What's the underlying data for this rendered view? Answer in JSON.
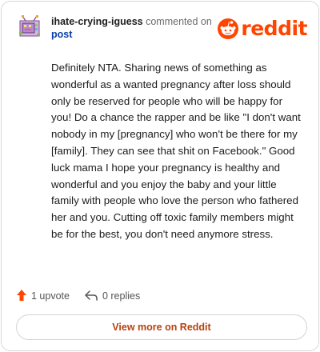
{
  "header": {
    "username": "ihate-crying-iguess",
    "action_text": "commented on",
    "post_link": "post",
    "avatar_icon": "pixel-tv-avatar-icon"
  },
  "brand": {
    "logo_icon": "reddit-snoo-icon",
    "wordmark": "reddit",
    "color": "#ff4500"
  },
  "comment": {
    "text": "Definitely NTA. Sharing news of something as wonderful as a wanted pregnancy after loss should only be reserved for people who will be happy for you! Do a chance the rapper and be like \"I don't want nobody in my [pregnancy] who won't be there for my [family]. They can see that shit on Facebook.\" Good luck mama I hope your pregnancy is healthy and wonderful and you enjoy the baby and your little family with people who love the person who fathered her and you. Cutting off toxic family members might be for the best, you don't need anymore stress."
  },
  "actions": {
    "upvote_icon": "upvote-arrow-icon",
    "upvote_label": "1 upvote",
    "reply_icon": "reply-arrow-icon",
    "replies_label": "0 replies"
  },
  "footer": {
    "view_more_label": "View more on Reddit",
    "accent_color": "#b7410e"
  }
}
